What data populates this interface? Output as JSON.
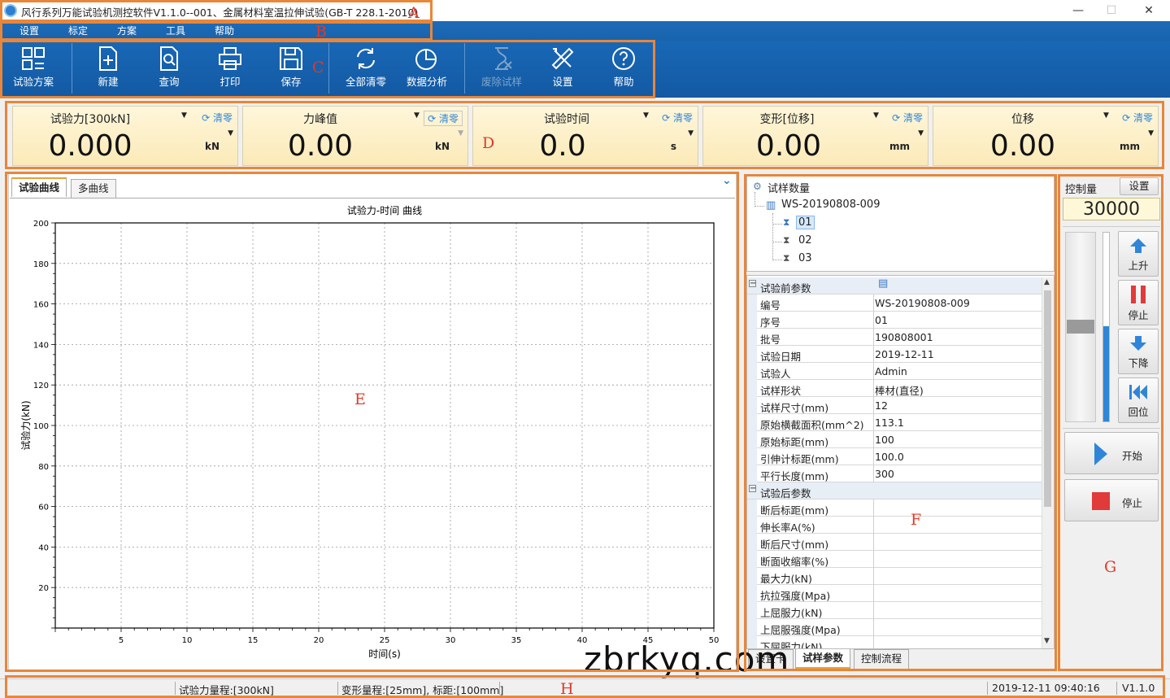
{
  "window": {
    "title": "风行系列万能试验机测控软件V1.1.0--001、金属材料室温拉伸试验(GB-T 228.1-2010)",
    "min": "—",
    "max": "☐",
    "close": "✕"
  },
  "menu": [
    "设置",
    "标定",
    "方案",
    "工具",
    "帮助"
  ],
  "toolbar": {
    "plan": "试验方案",
    "new": "新建",
    "query": "查询",
    "print": "打印",
    "save": "保存",
    "clear_all": "全部清零",
    "analysis": "数据分析",
    "discard": "废除试样",
    "settings": "设置",
    "help": "帮助"
  },
  "gauges": [
    {
      "title": "试验力[300kN]",
      "value": "0.000",
      "unit": "kN",
      "clear": "清零"
    },
    {
      "title": "力峰值",
      "value": "0.00",
      "unit": "kN",
      "clear": "清零"
    },
    {
      "title": "试验时间",
      "value": "0.0",
      "unit": "s",
      "clear": "清零"
    },
    {
      "title": "变形[位移]",
      "value": "0.00",
      "unit": "mm",
      "clear": "清零"
    },
    {
      "title": "位移",
      "value": "0.00",
      "unit": "mm",
      "clear": "清零"
    }
  ],
  "chart_tabs": [
    "试验曲线",
    "多曲线"
  ],
  "chart_data": {
    "type": "line",
    "title": "试验力-时间 曲线",
    "xlabel": "时间(s)",
    "ylabel": "试验力(kN)",
    "xlim": [
      0,
      50
    ],
    "ylim": [
      0,
      200
    ],
    "x_ticks": [
      5,
      10,
      15,
      20,
      25,
      30,
      35,
      40,
      45,
      50
    ],
    "y_ticks": [
      20,
      40,
      60,
      80,
      100,
      120,
      140,
      160,
      180,
      200
    ],
    "grid": true,
    "series": []
  },
  "tree": {
    "root": "试样数量",
    "batch": "WS-20190808-009",
    "items": [
      "01",
      "02",
      "03"
    ]
  },
  "params": {
    "pre_title": "试验前参数",
    "pre": [
      [
        "编号",
        "WS-20190808-009"
      ],
      [
        "序号",
        "01"
      ],
      [
        "批号",
        "190808001"
      ],
      [
        "试验日期",
        "2019-12-11"
      ],
      [
        "试验人",
        "Admin"
      ],
      [
        "试样形状",
        "棒材(直径)"
      ],
      [
        "试样尺寸(mm)",
        "12"
      ],
      [
        "原始横截面积(mm^2)",
        "113.1"
      ],
      [
        "原始标距(mm)",
        "100"
      ],
      [
        "引伸计标距(mm)",
        "100.0"
      ],
      [
        "平行长度(mm)",
        "300"
      ]
    ],
    "post_title": "试验后参数",
    "post": [
      [
        "断后标距(mm)",
        ""
      ],
      [
        "伸长率A(%)",
        ""
      ],
      [
        "断后尺寸(mm)",
        ""
      ],
      [
        "断面收缩率(%)",
        ""
      ],
      [
        "最大力(kN)",
        ""
      ],
      [
        "抗拉强度(Mpa)",
        ""
      ],
      [
        "上屈服力(kN)",
        ""
      ],
      [
        "上屈服强度(Mpa)",
        ""
      ],
      [
        "下屈服力(kN)",
        ""
      ]
    ],
    "tabs": [
      "设置卡",
      "试样参数",
      "控制流程"
    ]
  },
  "control": {
    "label": "控制量",
    "settings": "设置",
    "value": "30000",
    "up": "上升",
    "stop": "停止",
    "down": "下降",
    "return": "回位",
    "start": "开始",
    "stop2": "停止"
  },
  "status": {
    "range_force": "试验力量程:[300kN]",
    "range_deform": "变形量程:[25mm], 标距:[100mm]",
    "datetime": "2019-12-11 09:40:16",
    "version": "V1.1.0"
  },
  "watermark": "zbrkyq.com",
  "annotations": [
    "A",
    "B",
    "C",
    "D",
    "E",
    "F",
    "G",
    "H"
  ]
}
